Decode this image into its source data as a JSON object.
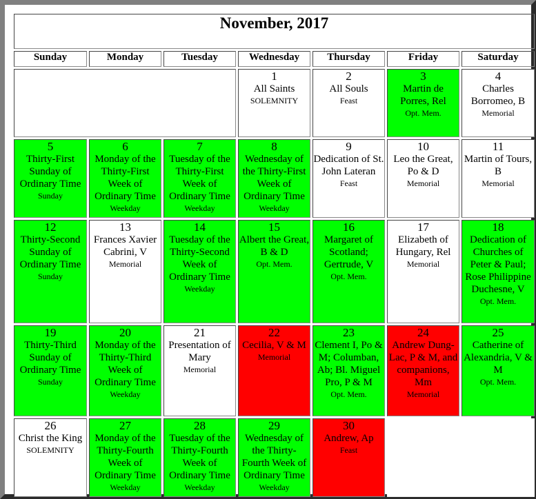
{
  "calendar": {
    "title": "November, 2017",
    "weekdays": [
      "Sunday",
      "Monday",
      "Tuesday",
      "Wednesday",
      "Thursday",
      "Friday",
      "Saturday"
    ],
    "colors": {
      "green": "#00ff00",
      "red": "#ff0000",
      "white": "#ffffff"
    },
    "days": [
      {
        "num": "1",
        "name": "All Saints",
        "rank": "SOLEMNITY",
        "color": "white"
      },
      {
        "num": "2",
        "name": "All Souls",
        "rank": "Feast",
        "color": "white"
      },
      {
        "num": "3",
        "name": "Martin de Porres, Rel",
        "rank": "Opt. Mem.",
        "color": "green"
      },
      {
        "num": "4",
        "name": "Charles Borromeo, B",
        "rank": "Memorial",
        "color": "white"
      },
      {
        "num": "5",
        "name": "Thirty-First Sunday of Ordinary Time",
        "rank": "Sunday",
        "color": "green"
      },
      {
        "num": "6",
        "name": "Monday of the Thirty-First Week of Ordinary Time",
        "rank": "Weekday",
        "color": "green"
      },
      {
        "num": "7",
        "name": "Tuesday of the Thirty-First Week of Ordinary Time",
        "rank": "Weekday",
        "color": "green"
      },
      {
        "num": "8",
        "name": "Wednesday of the Thirty-First Week of Ordinary Time",
        "rank": "Weekday",
        "color": "green"
      },
      {
        "num": "9",
        "name": "Dedication of St. John Lateran",
        "rank": "Feast",
        "color": "white"
      },
      {
        "num": "10",
        "name": "Leo the Great, Po & D",
        "rank": "Memorial",
        "color": "white"
      },
      {
        "num": "11",
        "name": "Martin of Tours, B",
        "rank": "Memorial",
        "color": "white"
      },
      {
        "num": "12",
        "name": "Thirty-Second Sunday of Ordinary Time",
        "rank": "Sunday",
        "color": "green"
      },
      {
        "num": "13",
        "name": "Frances Xavier Cabrini, V",
        "rank": "Memorial",
        "color": "white"
      },
      {
        "num": "14",
        "name": "Tuesday of the Thirty-Second Week of Ordinary Time",
        "rank": "Weekday",
        "color": "green"
      },
      {
        "num": "15",
        "name": "Albert the Great, B & D",
        "rank": "Opt. Mem.",
        "color": "green"
      },
      {
        "num": "16",
        "name": "Margaret of Scotland; Gertrude, V",
        "rank": "Opt. Mem.",
        "color": "green"
      },
      {
        "num": "17",
        "name": "Elizabeth of Hungary, Rel",
        "rank": "Memorial",
        "color": "white"
      },
      {
        "num": "18",
        "name": "Dedication of Churches of Peter & Paul; Rose Philippine Duchesne, V",
        "rank": "Opt. Mem.",
        "color": "green"
      },
      {
        "num": "19",
        "name": "Thirty-Third Sunday of Ordinary Time",
        "rank": "Sunday",
        "color": "green"
      },
      {
        "num": "20",
        "name": "Monday of the Thirty-Third Week of Ordinary Time",
        "rank": "Weekday",
        "color": "green"
      },
      {
        "num": "21",
        "name": "Presentation of Mary",
        "rank": "Memorial",
        "color": "white"
      },
      {
        "num": "22",
        "name": "Cecilia, V & M",
        "rank": "Memorial",
        "color": "red"
      },
      {
        "num": "23",
        "name": "Clement I, Po & M; Columban, Ab; Bl. Miguel Pro, P & M",
        "rank": "Opt. Mem.",
        "color": "green"
      },
      {
        "num": "24",
        "name": "Andrew Dung-Lac, P & M, and companions, Mm",
        "rank": "Memorial",
        "color": "red"
      },
      {
        "num": "25",
        "name": "Catherine of Alexandria, V & M",
        "rank": "Opt. Mem.",
        "color": "green"
      },
      {
        "num": "26",
        "name": "Christ the King",
        "rank": "SOLEMNITY",
        "color": "white"
      },
      {
        "num": "27",
        "name": "Monday of the Thirty-Fourth Week of Ordinary Time",
        "rank": "Weekday",
        "color": "green"
      },
      {
        "num": "28",
        "name": "Tuesday of the Thirty-Fourth Week of Ordinary Time",
        "rank": "Weekday",
        "color": "green"
      },
      {
        "num": "29",
        "name": "Wednesday of the Thirty-Fourth Week of Ordinary Time",
        "rank": "Weekday",
        "color": "green"
      },
      {
        "num": "30",
        "name": "Andrew, Ap",
        "rank": "Feast",
        "color": "red"
      }
    ]
  }
}
